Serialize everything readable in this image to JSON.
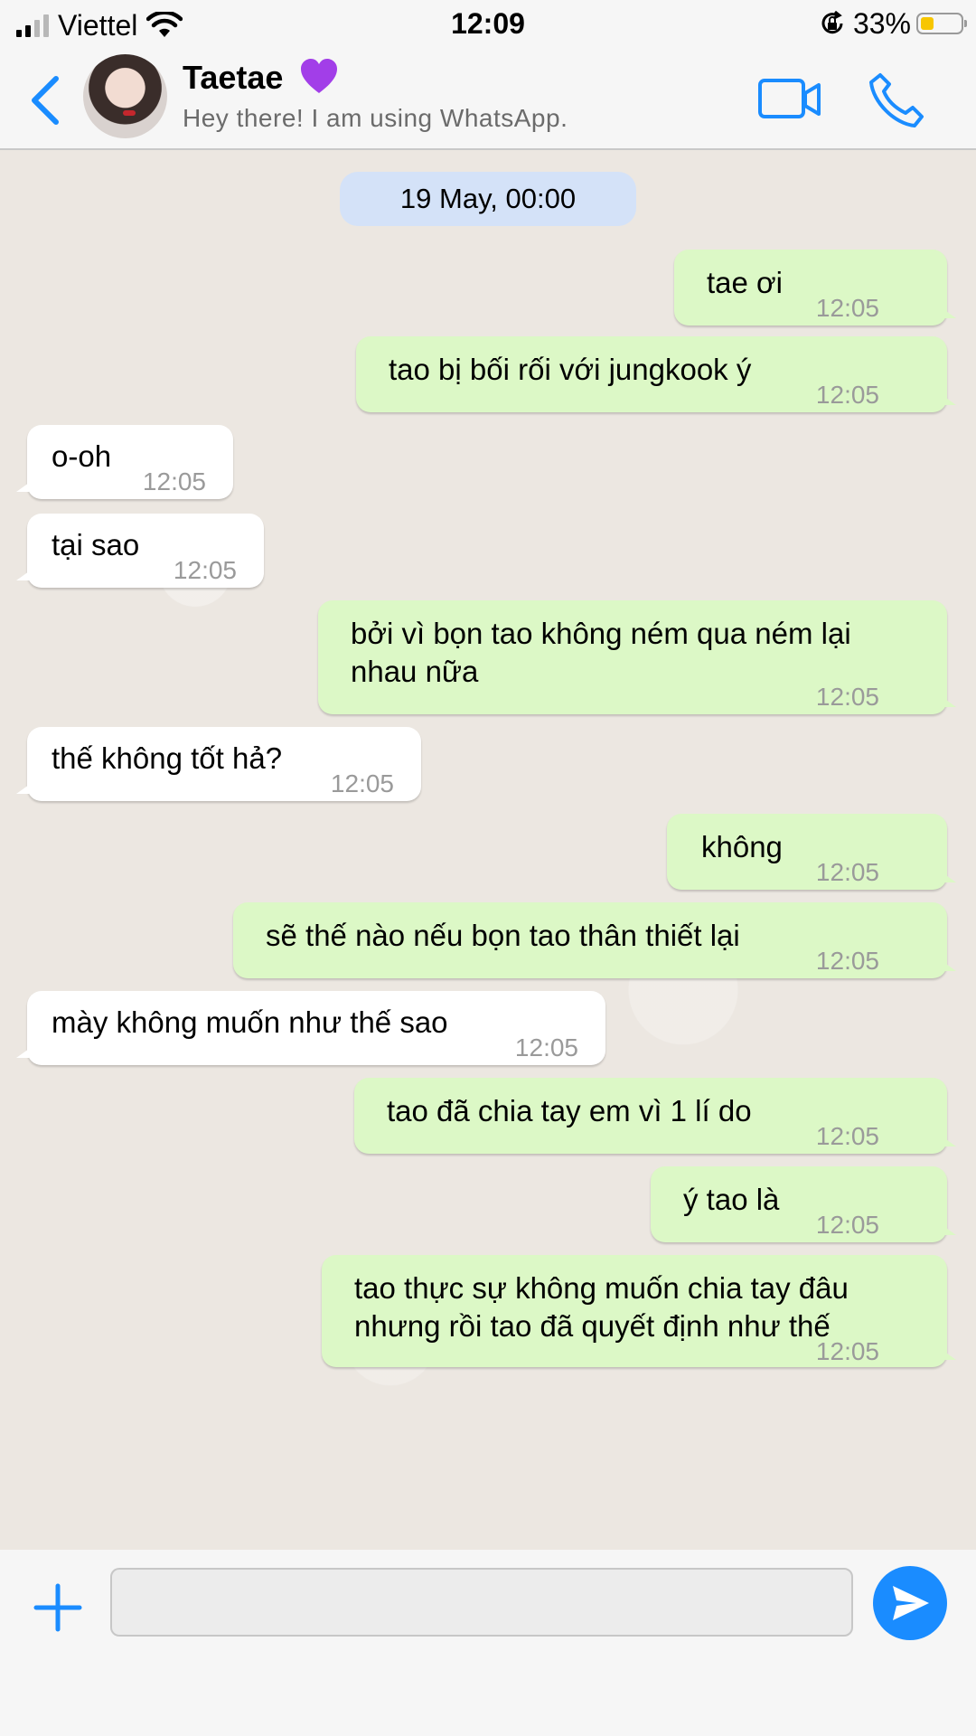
{
  "status_bar": {
    "carrier": "Viettel",
    "time": "12:09",
    "battery_percent": "33%",
    "battery_level": 0.33,
    "signal_bars": 2
  },
  "header": {
    "contact_name": "Taetae",
    "contact_emoji": "purple-heart",
    "contact_status": "Hey there! I am using WhatsApp.",
    "accent_color": "#1a8cff"
  },
  "chat": {
    "date_label": "19 May, 00:00",
    "messages": [
      {
        "direction": "out",
        "text": "tae ơi",
        "time": "12:05"
      },
      {
        "direction": "out",
        "text": "tao bị bối rối với jungkook ý",
        "time": "12:05"
      },
      {
        "direction": "in",
        "text": "o-oh",
        "time": "12:05"
      },
      {
        "direction": "in",
        "text": "tại sao",
        "time": "12:05"
      },
      {
        "direction": "out",
        "text": "bởi vì bọn tao không ném qua ném lại\nnhau nữa",
        "time": "12:05"
      },
      {
        "direction": "in",
        "text": "thế không tốt hả?",
        "time": "12:05"
      },
      {
        "direction": "out",
        "text": "không",
        "time": "12:05"
      },
      {
        "direction": "out",
        "text": "sẽ thế nào nếu bọn tao thân thiết lại",
        "time": "12:05"
      },
      {
        "direction": "in",
        "text": "mày không muốn như thế sao",
        "time": "12:05"
      },
      {
        "direction": "out",
        "text": "tao đã chia tay em vì 1 lí do",
        "time": "12:05"
      },
      {
        "direction": "out",
        "text": "ý tao là",
        "time": "12:05"
      },
      {
        "direction": "out",
        "text": "tao thực sự không muốn chia tay đâu\nnhưng rồi tao đã quyết định như thế",
        "time": "12:05"
      }
    ]
  },
  "composer": {
    "input_value": "",
    "send_color": "#1a8cff"
  }
}
